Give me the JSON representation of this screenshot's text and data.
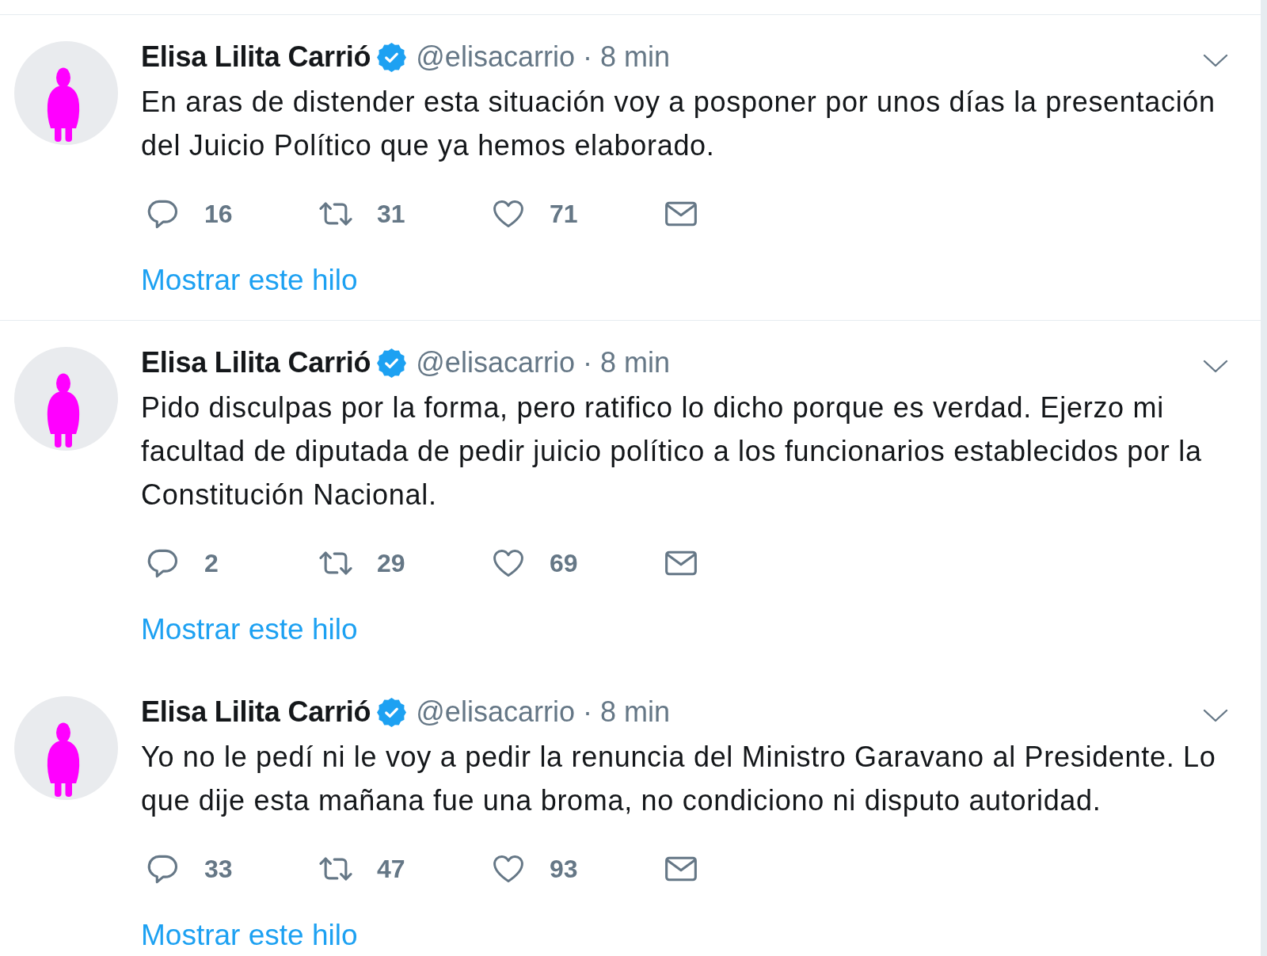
{
  "tweets": [
    {
      "divider_above": true,
      "author": "Elisa Lilita Carrió",
      "verified": true,
      "handle": "@elisacarrio",
      "separator": "·",
      "time": "8 min",
      "text": "En aras de distender esta situación voy a posponer por unos días la presentación del Juicio Político que ya hemos elaborado.",
      "actions": [
        {
          "kind": "reply",
          "count": "16"
        },
        {
          "kind": "retweet",
          "count": "31"
        },
        {
          "kind": "like",
          "count": "71"
        },
        {
          "kind": "message"
        }
      ],
      "thread_link": "Mostrar este hilo"
    },
    {
      "divider_above": true,
      "author": "Elisa Lilita Carrió",
      "verified": true,
      "handle": "@elisacarrio",
      "separator": "·",
      "time": "8 min",
      "text": "Pido disculpas por la forma, pero ratifico lo dicho porque es verdad. Ejerzo mi facultad de diputada de pedir juicio político a los funcionarios establecidos por la Constitución Nacional.",
      "actions": [
        {
          "kind": "reply",
          "count": "2"
        },
        {
          "kind": "retweet",
          "count": "29"
        },
        {
          "kind": "like",
          "count": "69"
        },
        {
          "kind": "message"
        }
      ],
      "thread_link": "Mostrar este hilo"
    },
    {
      "divider_above": false,
      "author": "Elisa Lilita Carrió",
      "verified": true,
      "handle": "@elisacarrio",
      "separator": "·",
      "time": "8 min",
      "text": "Yo no le pedí ni le voy a pedir la renuncia del Ministro Garavano al Presidente. Lo que dije esta mañana fue una broma, no condiciono ni disputo autoridad.",
      "actions": [
        {
          "kind": "reply",
          "count": "33"
        },
        {
          "kind": "retweet",
          "count": "47"
        },
        {
          "kind": "like",
          "count": "93"
        },
        {
          "kind": "message"
        }
      ],
      "thread_link": "Mostrar este hilo"
    }
  ]
}
